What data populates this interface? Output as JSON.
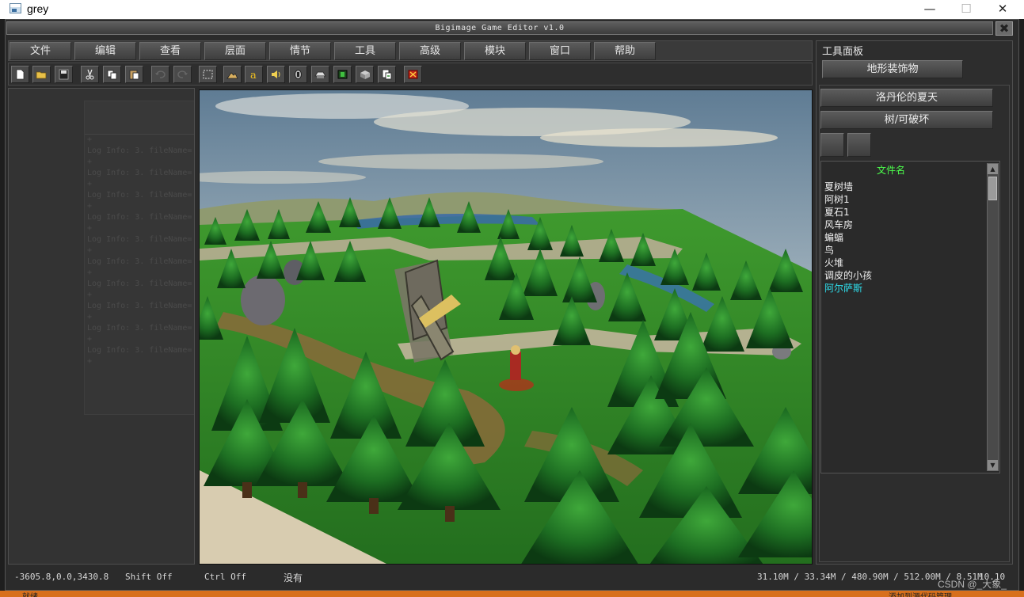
{
  "window": {
    "title": "grey",
    "minimize_glyph": "—",
    "maximize_glyph": "☐",
    "close_glyph": "✕"
  },
  "app": {
    "title": "Bigimage Game Editor v1.0",
    "close_glyph": "✖"
  },
  "menu": [
    "文件",
    "编辑",
    "查看",
    "层面",
    "情节",
    "工具",
    "高级",
    "模块",
    "窗口",
    "帮助"
  ],
  "toolbar": {
    "icons": [
      "new-file-icon",
      "open-folder-icon",
      "save-icon",
      "cut-icon",
      "copy-icon",
      "paste-icon",
      "undo-icon",
      "redo-icon",
      "select-region-icon",
      "terrain-icon",
      "text-icon",
      "sound-icon",
      "unit-icon",
      "doodad-icon",
      "region-icon",
      "camera-icon",
      "import-icon",
      "test-map-icon"
    ]
  },
  "log": {
    "lines": [
      "+",
      "Log Info: 3. fileName=",
      "+",
      "Log Info: 3. fileName=",
      "+",
      "Log Info: 3. fileName=",
      "+",
      "Log Info: 3. fileName=",
      "+",
      "Log Info: 3. fileName=",
      "+",
      "Log Info: 3. fileName=",
      "+",
      "Log Info: 3. fileName=",
      "+",
      "Log Info: 3. fileName=",
      "+",
      "Log Info: 3. fileName=",
      "+",
      "Log Info: 3. fileName=",
      "+"
    ]
  },
  "tool_panel": {
    "title": "工具面板",
    "category_button": "地形装饰物",
    "tileset_button": "洛丹伦的夏天",
    "type_button": "树/可破坏",
    "file_list": {
      "header": "文件名",
      "items": [
        "夏树墙",
        "阿树1",
        "夏石1",
        "风车房",
        "蝙蝠",
        "鸟",
        "火堆",
        "调皮的小孩",
        "阿尔萨斯"
      ],
      "selected_index": 8
    }
  },
  "status": {
    "coords": "-3605.8,0.0,3430.8",
    "shift": "Shift Off",
    "ctrl": "Ctrl Off",
    "selection": "没有",
    "memory": "31.10M / 33.34M / 480.90M / 512.00M / 8.51M",
    "fps": "10.10"
  },
  "watermark": "CSDN @_大象_",
  "taskbar": {
    "left_label": "就绪",
    "right_label": "添加到源代码管理"
  }
}
